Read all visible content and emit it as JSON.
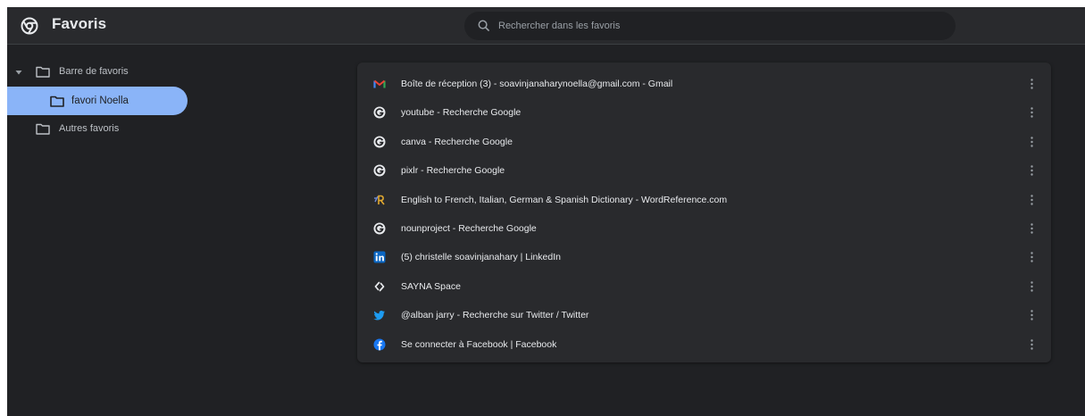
{
  "app": {
    "title": "Favoris",
    "logo_icon": "chrome-icon"
  },
  "search": {
    "placeholder": "Rechercher dans les favoris",
    "value": ""
  },
  "sidebar": {
    "items": [
      {
        "label": "Barre de favoris",
        "expanded": true,
        "icon": "folder-icon"
      },
      {
        "label": "favori Noella",
        "selected": true,
        "icon": "folder-icon"
      },
      {
        "label": "Autres favoris",
        "icon": "folder-icon"
      }
    ]
  },
  "bookmarks": [
    {
      "title": "Boîte de réception (3) - soavinjanaharynoella@gmail.com - Gmail",
      "icon": "gmail-icon"
    },
    {
      "title": "youtube - Recherche Google",
      "icon": "google-icon"
    },
    {
      "title": "canva - Recherche Google",
      "icon": "google-icon"
    },
    {
      "title": "pixlr - Recherche Google",
      "icon": "google-icon"
    },
    {
      "title": "English to French, Italian, German & Spanish Dictionary - WordReference.com",
      "icon": "wordreference-icon"
    },
    {
      "title": "nounproject - Recherche Google",
      "icon": "google-icon"
    },
    {
      "title": "(5) christelle soavinjanahary | LinkedIn",
      "icon": "linkedin-icon"
    },
    {
      "title": "SAYNA Space",
      "icon": "sayna-icon"
    },
    {
      "title": "@alban jarry - Recherche sur Twitter / Twitter",
      "icon": "twitter-icon"
    },
    {
      "title": "Se connecter à Facebook | Facebook",
      "icon": "facebook-icon"
    }
  ],
  "colors": {
    "background": "#202124",
    "toolbar": "#292a2d",
    "accent": "#8ab4f8",
    "text": "#e8eaed",
    "muted": "#9aa0a6"
  }
}
